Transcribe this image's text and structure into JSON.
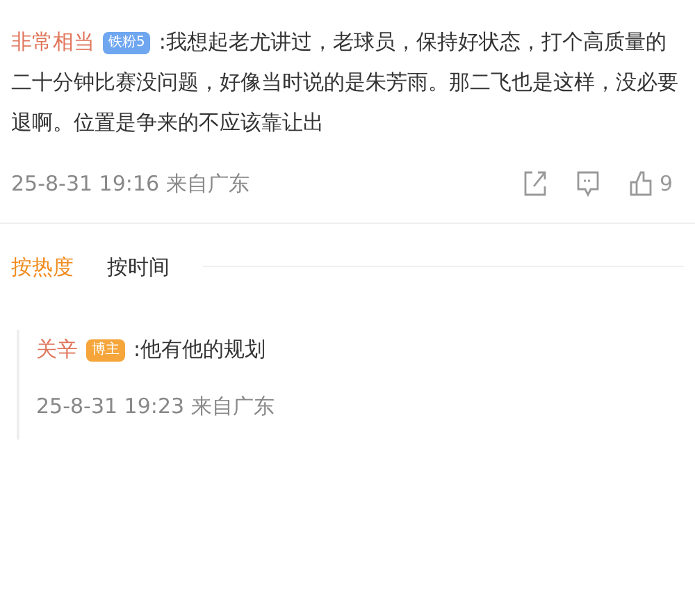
{
  "comment": {
    "author": "非常相当",
    "badge": {
      "kind": "fan",
      "label": "铁粉5"
    },
    "text": ":我想起老尤讲过，老球员，保持好状态，打个高质量的二十分钟比赛没问题，好像当时说的是朱芳雨。那二飞也是这样，没必要退啊。位置是争来的不应该靠让出",
    "meta": "25-8-31 19:16 来自广东",
    "likes": "9"
  },
  "sort_tabs": [
    {
      "label": "按热度",
      "selected": true
    },
    {
      "label": "按时间",
      "selected": false
    }
  ],
  "replies": [
    {
      "author": "关辛",
      "badge": {
        "kind": "host",
        "label": "博主"
      },
      "text": ":他有他的规划",
      "meta": "25-8-31 19:23 来自广东"
    }
  ]
}
